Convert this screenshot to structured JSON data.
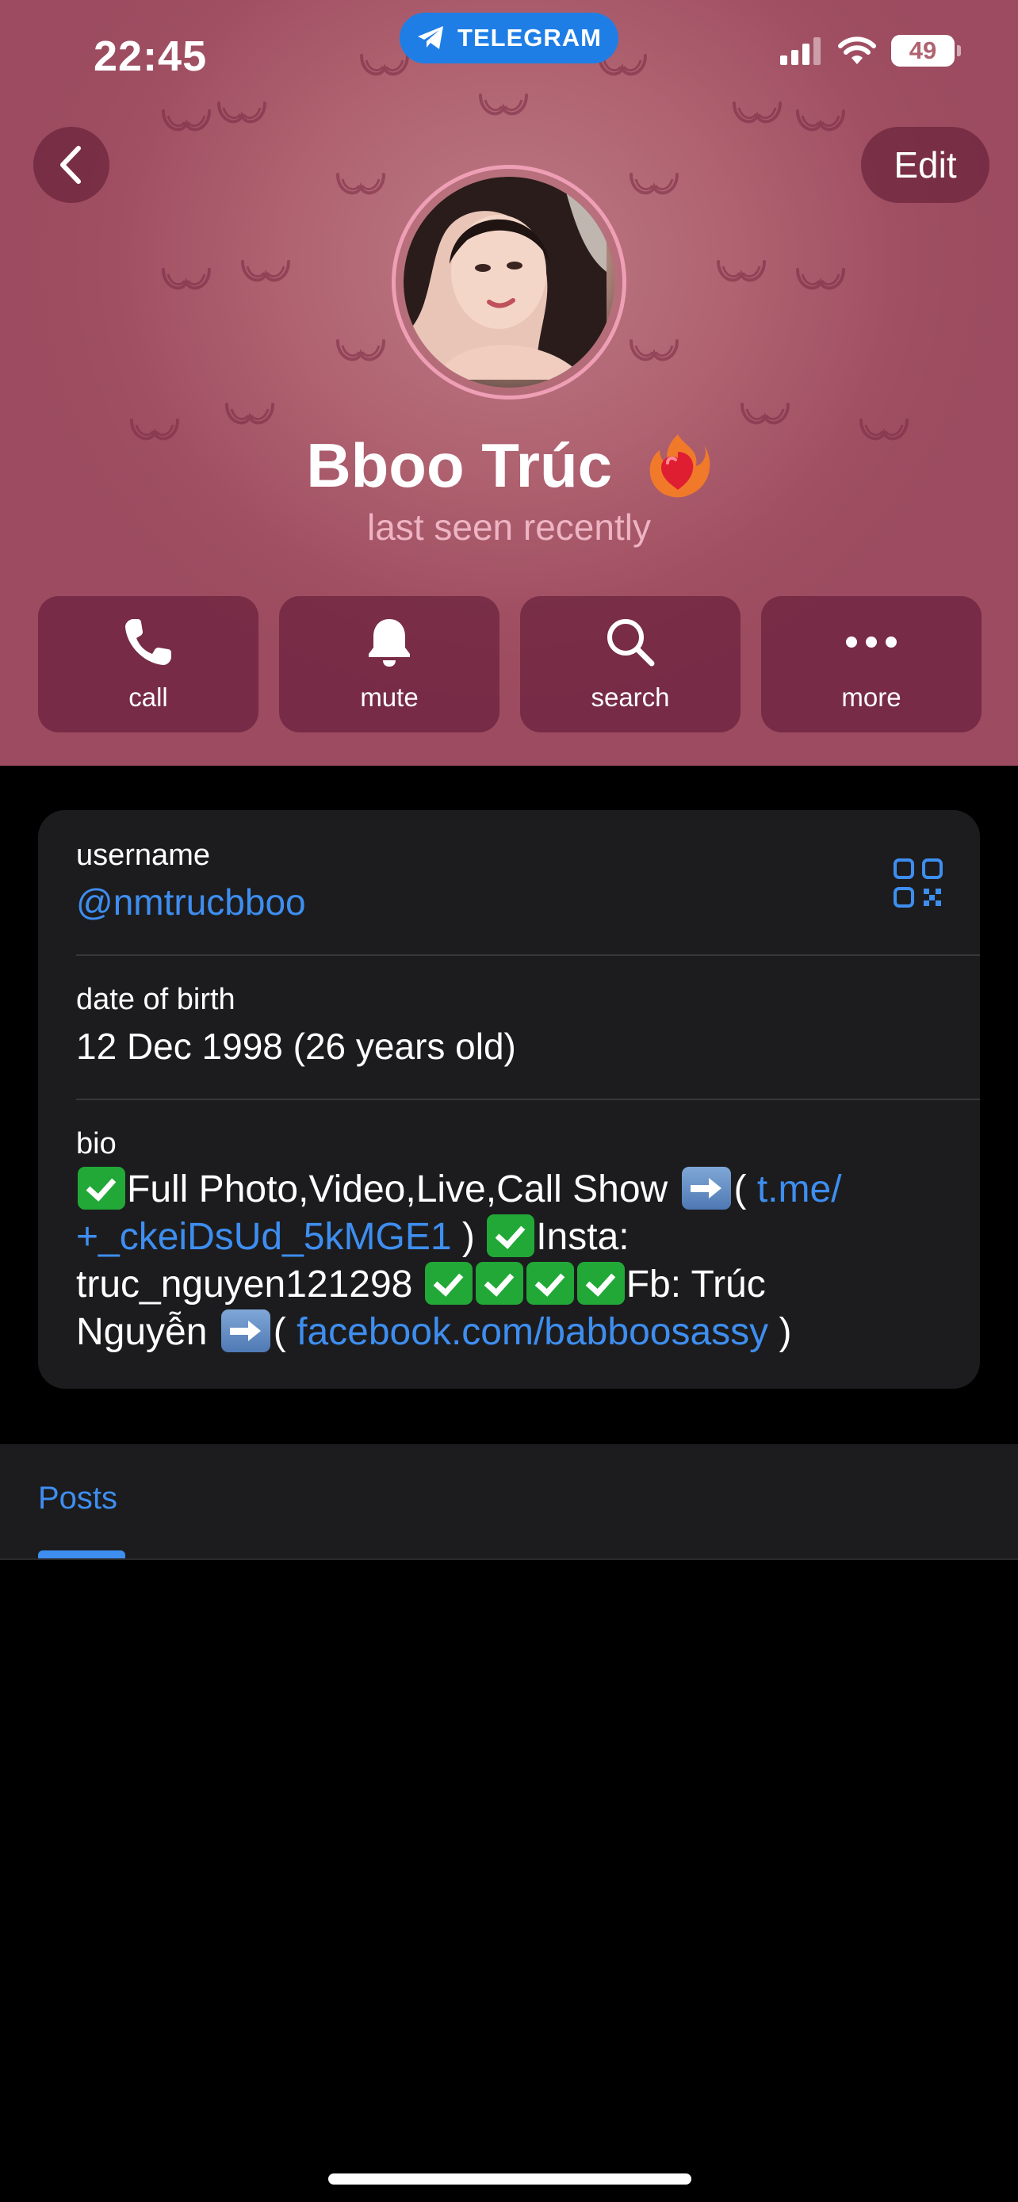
{
  "status_bar": {
    "time": "22:45",
    "app_pill_label": "TELEGRAM",
    "battery_level": "49"
  },
  "header": {
    "back_icon": "chevron-left-icon",
    "edit_label": "Edit",
    "profile_name": "Bboo Trúc",
    "name_emoji": "heart-on-fire",
    "last_seen": "last seen recently"
  },
  "actions": [
    {
      "label": "call",
      "icon": "phone-icon"
    },
    {
      "label": "mute",
      "icon": "bell-icon"
    },
    {
      "label": "search",
      "icon": "search-icon"
    },
    {
      "label": "more",
      "icon": "more-icon"
    }
  ],
  "info": {
    "username_label": "username",
    "username_value": "@nmtrucbboo",
    "dob_label": "date of birth",
    "dob_value": "12 Dec 1998 (26 years old)",
    "bio_label": "bio",
    "bio": {
      "p1": "Full Photo,Video,Live,Call Show",
      "p2": "( ",
      "link1": "t.me/\n+_ckeiDsUd_5kMGE1",
      "p3": " )",
      "p4": "Insta:\ntruc_nguyen121298",
      "p5": "Fb: Trúc\nNguyễn",
      "p6": "( ",
      "link2": "facebook.com/babboosassy",
      "p7": " )"
    }
  },
  "tabs": {
    "posts_label": "Posts"
  },
  "colors": {
    "header_bg": "#b06371",
    "link": "#3e8ef0",
    "card_bg": "#1c1c1e",
    "telegram_blue": "#1f7ee6"
  }
}
